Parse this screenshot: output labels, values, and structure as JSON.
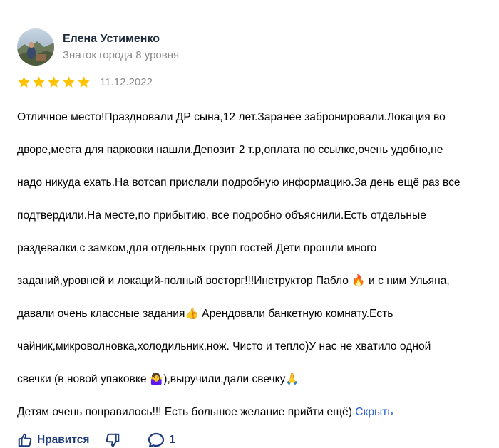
{
  "review": {
    "author": {
      "name": "Елена Устименко",
      "level": "Знаток города 8 уровня",
      "avatar": "avatar-photo"
    },
    "rating": 5,
    "date": "11.12.2022",
    "text_lines": [
      "Отличное место!Праздновали ДР сына,12 лет.Заранее забронировали.Локация во",
      "дворе,места для парковки нашли.Депозит 2 т.р,оплата по ссылке,очень удобно,не",
      "надо никуда ехать.На вотсап прислали подробную информацию.За день ещё раз все",
      "подтвердили.На месте,по прибытию, все подробно объяснили.Есть отдельные",
      "раздевалки,с замком,для отдельных групп гостей.Дети прошли много",
      "заданий,уровней и локаций-полный восторг!!!Инструктор Пабло 🔥 и с ним Ульяна,",
      "давали очень классные задания👍 Арендовали банкетную комнату.Есть",
      "чайник,микроволновка,холодильник,нож. Чисто и тепло)У нас не хватило одной",
      "свечки (в новой упаковке 🤷‍♀️),выручили,дали свечку🙏",
      "Детям очень понравилось!!! Есть большое желание прийти ещё)"
    ],
    "collapse_label": "Скрыть",
    "actions": {
      "like_label": "Нравится",
      "comment_count": "1"
    },
    "colors": {
      "star": "#fdc300",
      "link": "#2c5fd6",
      "action": "#1d3a7a",
      "muted": "#8a8a8a"
    },
    "icons": [
      "star-icon",
      "thumbs-up-icon",
      "thumbs-down-icon",
      "comment-icon"
    ]
  }
}
